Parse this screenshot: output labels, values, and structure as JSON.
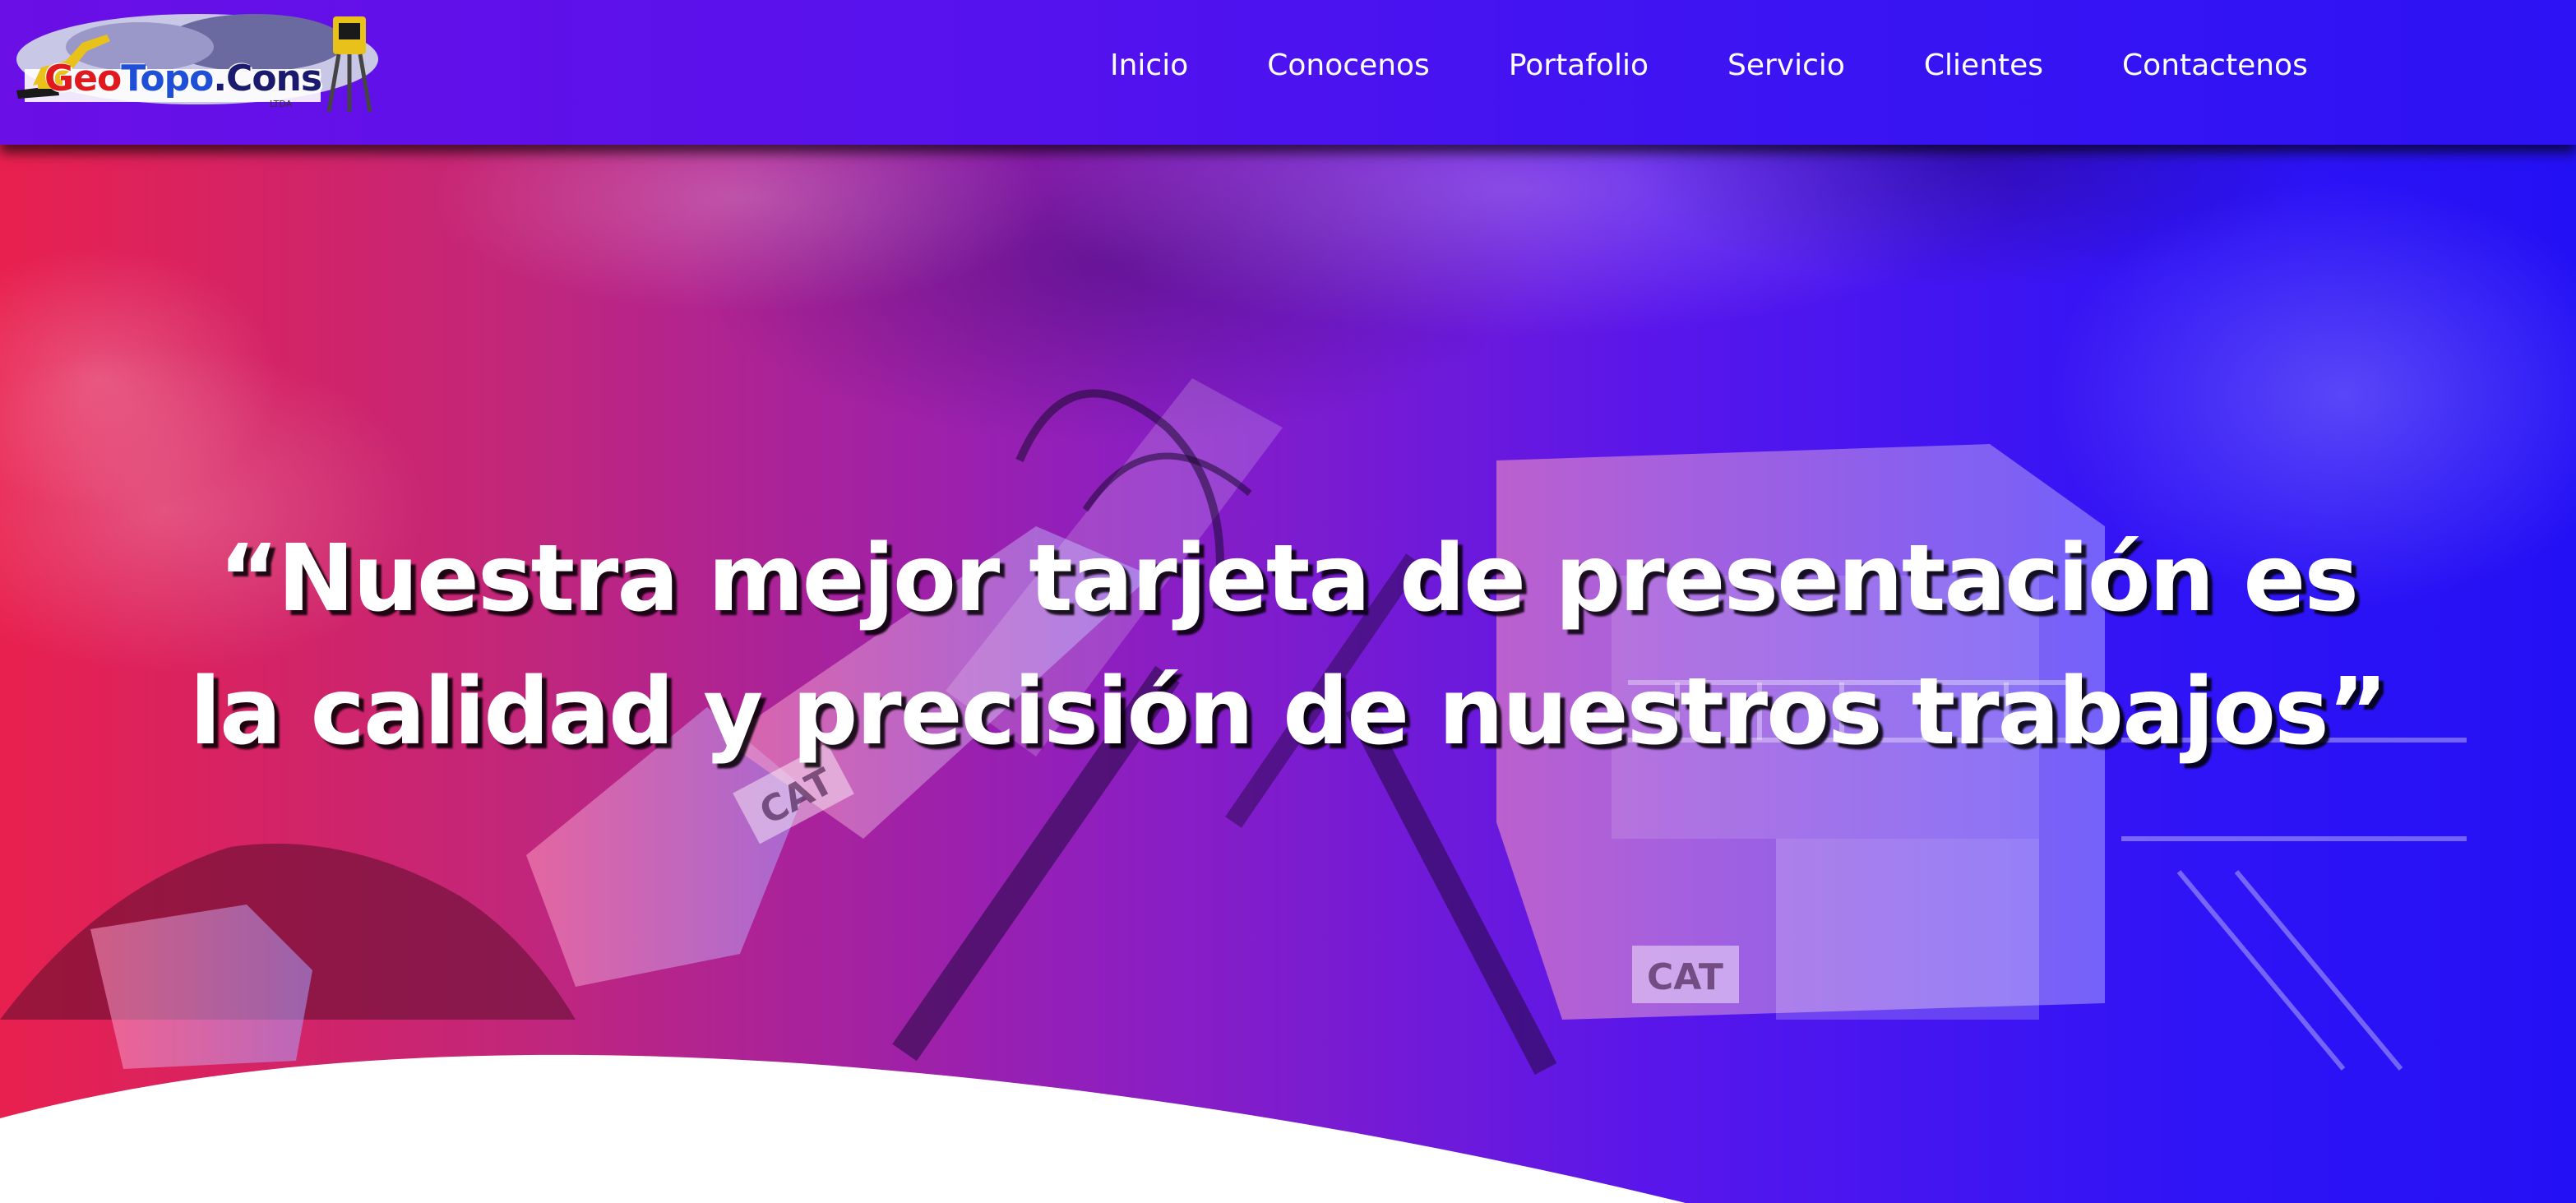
{
  "brand": {
    "logo_geo": "Geo",
    "logo_topo": "Topo",
    "logo_cons": ".Cons",
    "logo_ltda": "LTDA"
  },
  "nav": {
    "items": [
      {
        "label": "Inicio"
      },
      {
        "label": "Conocenos"
      },
      {
        "label": "Portafolio"
      },
      {
        "label": "Servicio"
      },
      {
        "label": "Clientes"
      },
      {
        "label": "Contactenos"
      }
    ]
  },
  "hero": {
    "quote_line_1": "“Nuestra mejor tarjeta de presentación es",
    "quote_line_2": "la calidad y precisión de nuestros trabajos”",
    "machine_badge_1": "CAT",
    "machine_badge_2": "CAT"
  },
  "colors": {
    "gradient_left": "#e8204f",
    "gradient_mid": "#8a1ec4",
    "gradient_right": "#2410f5",
    "header": "#4a12f0",
    "text": "#ffffff"
  },
  "icons": {
    "logo": "excavator-total-station-logo"
  }
}
